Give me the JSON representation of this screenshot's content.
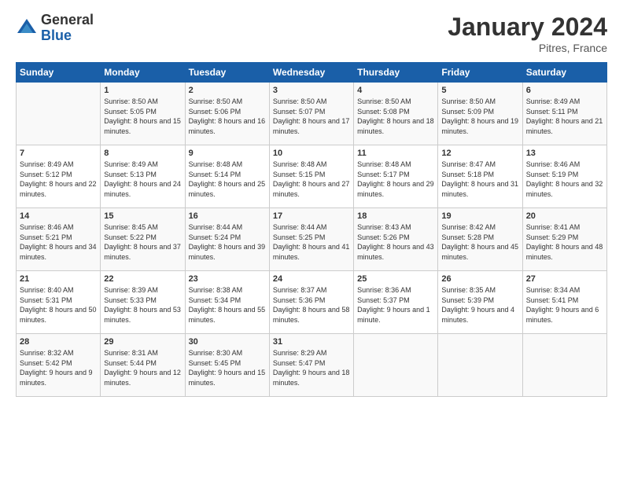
{
  "logo": {
    "general": "General",
    "blue": "Blue"
  },
  "title": "January 2024",
  "location": "Pitres, France",
  "days_of_week": [
    "Sunday",
    "Monday",
    "Tuesday",
    "Wednesday",
    "Thursday",
    "Friday",
    "Saturday"
  ],
  "weeks": [
    [
      {
        "day": "",
        "sunrise": "",
        "sunset": "",
        "daylight": ""
      },
      {
        "day": "1",
        "sunrise": "Sunrise: 8:50 AM",
        "sunset": "Sunset: 5:05 PM",
        "daylight": "Daylight: 8 hours and 15 minutes."
      },
      {
        "day": "2",
        "sunrise": "Sunrise: 8:50 AM",
        "sunset": "Sunset: 5:06 PM",
        "daylight": "Daylight: 8 hours and 16 minutes."
      },
      {
        "day": "3",
        "sunrise": "Sunrise: 8:50 AM",
        "sunset": "Sunset: 5:07 PM",
        "daylight": "Daylight: 8 hours and 17 minutes."
      },
      {
        "day": "4",
        "sunrise": "Sunrise: 8:50 AM",
        "sunset": "Sunset: 5:08 PM",
        "daylight": "Daylight: 8 hours and 18 minutes."
      },
      {
        "day": "5",
        "sunrise": "Sunrise: 8:50 AM",
        "sunset": "Sunset: 5:09 PM",
        "daylight": "Daylight: 8 hours and 19 minutes."
      },
      {
        "day": "6",
        "sunrise": "Sunrise: 8:49 AM",
        "sunset": "Sunset: 5:11 PM",
        "daylight": "Daylight: 8 hours and 21 minutes."
      }
    ],
    [
      {
        "day": "7",
        "sunrise": "Sunrise: 8:49 AM",
        "sunset": "Sunset: 5:12 PM",
        "daylight": "Daylight: 8 hours and 22 minutes."
      },
      {
        "day": "8",
        "sunrise": "Sunrise: 8:49 AM",
        "sunset": "Sunset: 5:13 PM",
        "daylight": "Daylight: 8 hours and 24 minutes."
      },
      {
        "day": "9",
        "sunrise": "Sunrise: 8:48 AM",
        "sunset": "Sunset: 5:14 PM",
        "daylight": "Daylight: 8 hours and 25 minutes."
      },
      {
        "day": "10",
        "sunrise": "Sunrise: 8:48 AM",
        "sunset": "Sunset: 5:15 PM",
        "daylight": "Daylight: 8 hours and 27 minutes."
      },
      {
        "day": "11",
        "sunrise": "Sunrise: 8:48 AM",
        "sunset": "Sunset: 5:17 PM",
        "daylight": "Daylight: 8 hours and 29 minutes."
      },
      {
        "day": "12",
        "sunrise": "Sunrise: 8:47 AM",
        "sunset": "Sunset: 5:18 PM",
        "daylight": "Daylight: 8 hours and 31 minutes."
      },
      {
        "day": "13",
        "sunrise": "Sunrise: 8:46 AM",
        "sunset": "Sunset: 5:19 PM",
        "daylight": "Daylight: 8 hours and 32 minutes."
      }
    ],
    [
      {
        "day": "14",
        "sunrise": "Sunrise: 8:46 AM",
        "sunset": "Sunset: 5:21 PM",
        "daylight": "Daylight: 8 hours and 34 minutes."
      },
      {
        "day": "15",
        "sunrise": "Sunrise: 8:45 AM",
        "sunset": "Sunset: 5:22 PM",
        "daylight": "Daylight: 8 hours and 37 minutes."
      },
      {
        "day": "16",
        "sunrise": "Sunrise: 8:44 AM",
        "sunset": "Sunset: 5:24 PM",
        "daylight": "Daylight: 8 hours and 39 minutes."
      },
      {
        "day": "17",
        "sunrise": "Sunrise: 8:44 AM",
        "sunset": "Sunset: 5:25 PM",
        "daylight": "Daylight: 8 hours and 41 minutes."
      },
      {
        "day": "18",
        "sunrise": "Sunrise: 8:43 AM",
        "sunset": "Sunset: 5:26 PM",
        "daylight": "Daylight: 8 hours and 43 minutes."
      },
      {
        "day": "19",
        "sunrise": "Sunrise: 8:42 AM",
        "sunset": "Sunset: 5:28 PM",
        "daylight": "Daylight: 8 hours and 45 minutes."
      },
      {
        "day": "20",
        "sunrise": "Sunrise: 8:41 AM",
        "sunset": "Sunset: 5:29 PM",
        "daylight": "Daylight: 8 hours and 48 minutes."
      }
    ],
    [
      {
        "day": "21",
        "sunrise": "Sunrise: 8:40 AM",
        "sunset": "Sunset: 5:31 PM",
        "daylight": "Daylight: 8 hours and 50 minutes."
      },
      {
        "day": "22",
        "sunrise": "Sunrise: 8:39 AM",
        "sunset": "Sunset: 5:33 PM",
        "daylight": "Daylight: 8 hours and 53 minutes."
      },
      {
        "day": "23",
        "sunrise": "Sunrise: 8:38 AM",
        "sunset": "Sunset: 5:34 PM",
        "daylight": "Daylight: 8 hours and 55 minutes."
      },
      {
        "day": "24",
        "sunrise": "Sunrise: 8:37 AM",
        "sunset": "Sunset: 5:36 PM",
        "daylight": "Daylight: 8 hours and 58 minutes."
      },
      {
        "day": "25",
        "sunrise": "Sunrise: 8:36 AM",
        "sunset": "Sunset: 5:37 PM",
        "daylight": "Daylight: 9 hours and 1 minute."
      },
      {
        "day": "26",
        "sunrise": "Sunrise: 8:35 AM",
        "sunset": "Sunset: 5:39 PM",
        "daylight": "Daylight: 9 hours and 4 minutes."
      },
      {
        "day": "27",
        "sunrise": "Sunrise: 8:34 AM",
        "sunset": "Sunset: 5:41 PM",
        "daylight": "Daylight: 9 hours and 6 minutes."
      }
    ],
    [
      {
        "day": "28",
        "sunrise": "Sunrise: 8:32 AM",
        "sunset": "Sunset: 5:42 PM",
        "daylight": "Daylight: 9 hours and 9 minutes."
      },
      {
        "day": "29",
        "sunrise": "Sunrise: 8:31 AM",
        "sunset": "Sunset: 5:44 PM",
        "daylight": "Daylight: 9 hours and 12 minutes."
      },
      {
        "day": "30",
        "sunrise": "Sunrise: 8:30 AM",
        "sunset": "Sunset: 5:45 PM",
        "daylight": "Daylight: 9 hours and 15 minutes."
      },
      {
        "day": "31",
        "sunrise": "Sunrise: 8:29 AM",
        "sunset": "Sunset: 5:47 PM",
        "daylight": "Daylight: 9 hours and 18 minutes."
      },
      {
        "day": "",
        "sunrise": "",
        "sunset": "",
        "daylight": ""
      },
      {
        "day": "",
        "sunrise": "",
        "sunset": "",
        "daylight": ""
      },
      {
        "day": "",
        "sunrise": "",
        "sunset": "",
        "daylight": ""
      }
    ]
  ]
}
